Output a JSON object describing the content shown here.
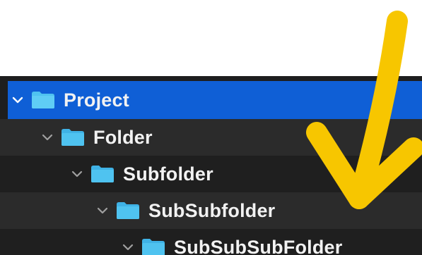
{
  "tree": {
    "items": [
      {
        "label": "Project",
        "level": 0,
        "expanded": true,
        "selected": true
      },
      {
        "label": "Folder",
        "level": 1,
        "expanded": true,
        "selected": false
      },
      {
        "label": "Subfolder",
        "level": 2,
        "expanded": true,
        "selected": false
      },
      {
        "label": "SubSubfolder",
        "level": 3,
        "expanded": true,
        "selected": false
      },
      {
        "label": "SubSubSubFolder",
        "level": 4,
        "expanded": true,
        "selected": false
      }
    ]
  },
  "colors": {
    "selection": "#0f5fd6",
    "folder_icon": "#4fc3f0",
    "arrow": "#f7c600",
    "background": "#1e1e1e"
  },
  "icons": {
    "disclosure": "chevron-down-icon",
    "folder": "folder-icon",
    "annotation": "arrow-down-icon"
  }
}
